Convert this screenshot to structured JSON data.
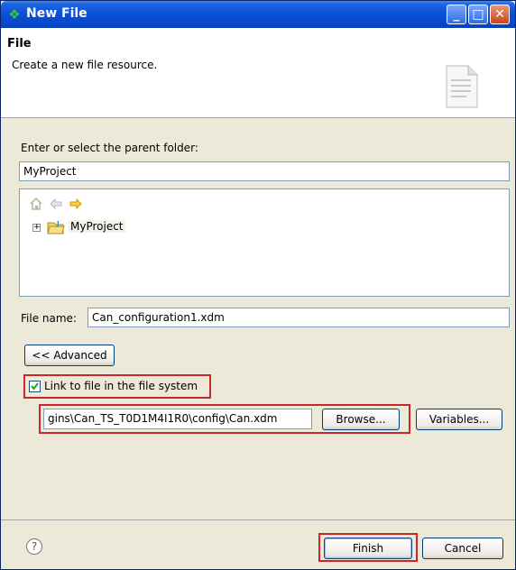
{
  "window": {
    "title": "New File",
    "minimize": "_",
    "maximize": "□",
    "close": "✕"
  },
  "header": {
    "title": "File",
    "description": "Create a new file resource."
  },
  "folder": {
    "label": "Enter or select the parent folder:",
    "value": "MyProject"
  },
  "tree": {
    "items": [
      {
        "label": "MyProject",
        "expander": "+"
      }
    ]
  },
  "file_name": {
    "label": "File name:",
    "value": "Can_configuration1.xdm"
  },
  "advanced_button": "<< Advanced",
  "link": {
    "checkbox_label": "Link to file in the file system",
    "checked": true,
    "path_value": "gins\\Can_TS_T0D1M4I1R0\\config\\Can.xdm",
    "browse_label": "Browse...",
    "variables_label": "Variables..."
  },
  "footer": {
    "help": "?",
    "finish_label": "Finish",
    "cancel_label": "Cancel"
  },
  "colors": {
    "titlebar": "#0a4fd8",
    "highlight_box": "#c8272c",
    "arrow_forward": "#f0b400"
  }
}
